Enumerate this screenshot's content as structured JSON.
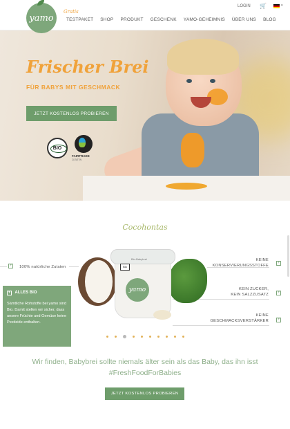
{
  "header": {
    "logo_text": "yamo",
    "gratis_label": "Gratis",
    "nav": [
      "TESTPAKET",
      "SHOP",
      "PRODUKT",
      "GESCHENK",
      "YAMO-GEHEIMNIS",
      "ÜBER UNS",
      "BLOG"
    ],
    "login_label": "LOGIN",
    "cart_icon": "shopping-cart-icon",
    "language_flag": "german-flag-icon"
  },
  "hero": {
    "title": "Frischer Brei",
    "subtitle": "FÜR BABYS MIT GESCHMACK",
    "cta_label": "JETZT KOSTENLOS PROBIEREN",
    "bio_badge": "BIO",
    "fairtrade_label": "FAIRTRADE",
    "fairtrade_sub": "ZUTATEN"
  },
  "product": {
    "name": "Cocohontas",
    "cup_bio": "Bio",
    "cup_label": "Bio-Babybrei",
    "cup_logo": "yamo",
    "features": {
      "left1": "100% natürliche Zutaten",
      "right1_line1": "KEINE",
      "right1_line2": "KONSERVIERUNGSSTOFFE",
      "right2_line1": "KEIN ZUCKER,",
      "right2_line2": "KEIN SALZZUSATZ",
      "right3_line1": "KEINE",
      "right3_line2": "GESCHMACKSVERSTÄRKER"
    },
    "info_box": {
      "title": "ALLES BIO",
      "text": "Sämtliche Rohstoffe bei yamo sind Bio. Damit stellen wir sicher, dass unsere Früchte und Gemüse keine Pestizide enthalten."
    },
    "carousel_pages": 10,
    "carousel_active": 3
  },
  "claim": {
    "line1": "Wir finden, Babybrei sollte niemals älter sein als das Baby, das ihn isst",
    "line2": "#FreshFoodForBabies"
  },
  "bottom_cta_label": "JETZT KOSTENLOS PROBIEREN",
  "colors": {
    "accent_green": "#6e9d6b",
    "accent_orange": "#f0a23a"
  }
}
